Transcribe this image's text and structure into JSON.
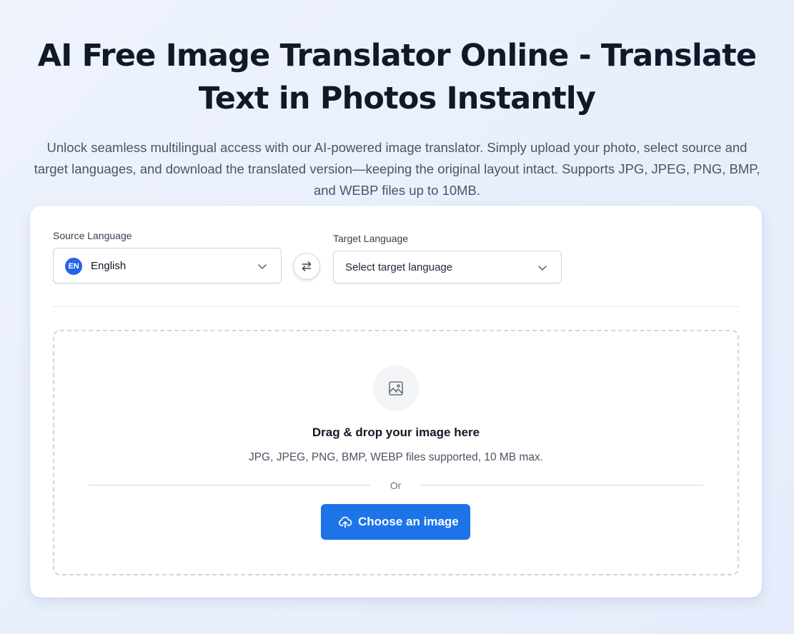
{
  "hero": {
    "title": "AI Free Image Translator Online - Translate Text in Photos Instantly",
    "subtitle": "Unlock seamless multilingual access with our AI-powered image translator. Simply upload your photo, select source and target languages, and download the translated version—keeping the original layout intact. Supports JPG, JPEG, PNG, BMP, and WEBP files up to 10MB."
  },
  "source": {
    "label": "Source Language",
    "badge": "EN",
    "value": "English"
  },
  "target": {
    "label": "Target Language",
    "placeholder": "Select target language"
  },
  "upload": {
    "title": "Drag & drop your image here",
    "hint": "JPG, JPEG, PNG, BMP, WEBP files supported, 10 MB max.",
    "or": "Or",
    "button_label": "Choose an image"
  },
  "colors": {
    "primary": "#1d74e8",
    "badge": "#2563eb",
    "heading": "#111827",
    "body_text": "#4b5563"
  },
  "icons": {
    "dropdown": "chevron-down-icon",
    "swap": "swap-arrows-icon",
    "image": "image-icon",
    "upload": "cloud-upload-icon"
  }
}
